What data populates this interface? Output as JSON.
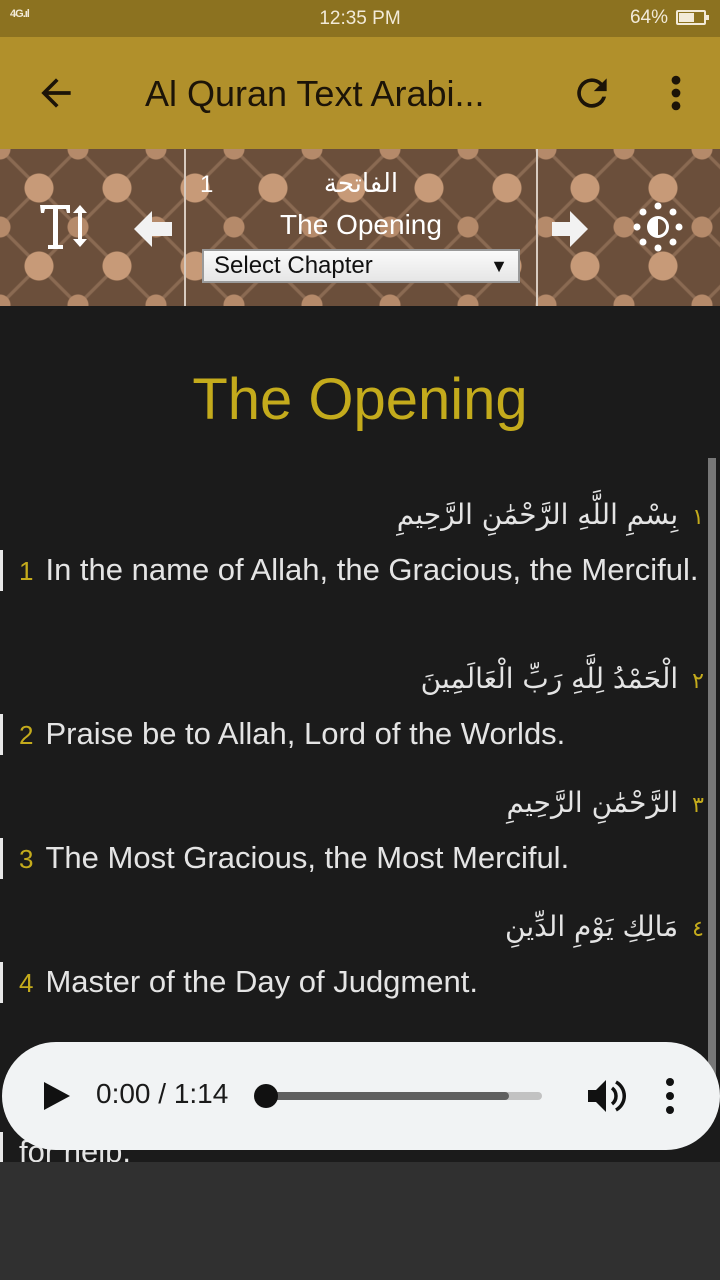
{
  "status_bar": {
    "network": "4G",
    "time": "12:35 PM",
    "battery_percent": "64%",
    "battery_level": 0.64
  },
  "app_bar": {
    "title": "Al Quran Text Arabi...",
    "icons": [
      "arrow-back-icon",
      "refresh-icon",
      "more-vert-icon"
    ]
  },
  "chapter_nav": {
    "number": "1",
    "arabic_name": "الفاتحة",
    "english_name": "The Opening",
    "select_label": "Select Chapter",
    "icons": [
      "text-size-icon",
      "prev-arrow-icon",
      "next-arrow-icon",
      "brightness-icon"
    ]
  },
  "surah": {
    "title": "The Opening",
    "verses": [
      {
        "ar_num": "١",
        "arabic": "بِسْمِ اللَّهِ الرَّحْمَٰنِ الرَّحِيمِ",
        "num": "1",
        "english": "In the name of Allah, the Gracious, the Merciful."
      },
      {
        "ar_num": "٢",
        "arabic": "الْحَمْدُ لِلَّهِ رَبِّ الْعَالَمِينَ",
        "num": "2",
        "english": "Praise be to Allah, Lord of the Worlds."
      },
      {
        "ar_num": "٣",
        "arabic": "الرَّحْمَٰنِ الرَّحِيمِ",
        "num": "3",
        "english": "The Most Gracious, the Most Merciful."
      },
      {
        "ar_num": "٤",
        "arabic": "مَالِكِ يَوْمِ الدِّينِ",
        "num": "4",
        "english": "Master of the Day of Judgment."
      }
    ],
    "partial_text": "for help."
  },
  "audio_player": {
    "time_display": "0:00 / 1:14",
    "progress": 0,
    "buffered": 0.88
  },
  "colors": {
    "status_bar": "#8c7220",
    "app_bar": "#b1902b",
    "accent": "#c4ab1c",
    "content_bg": "#1b1b1b",
    "player_bg": "#f1f3f4"
  }
}
